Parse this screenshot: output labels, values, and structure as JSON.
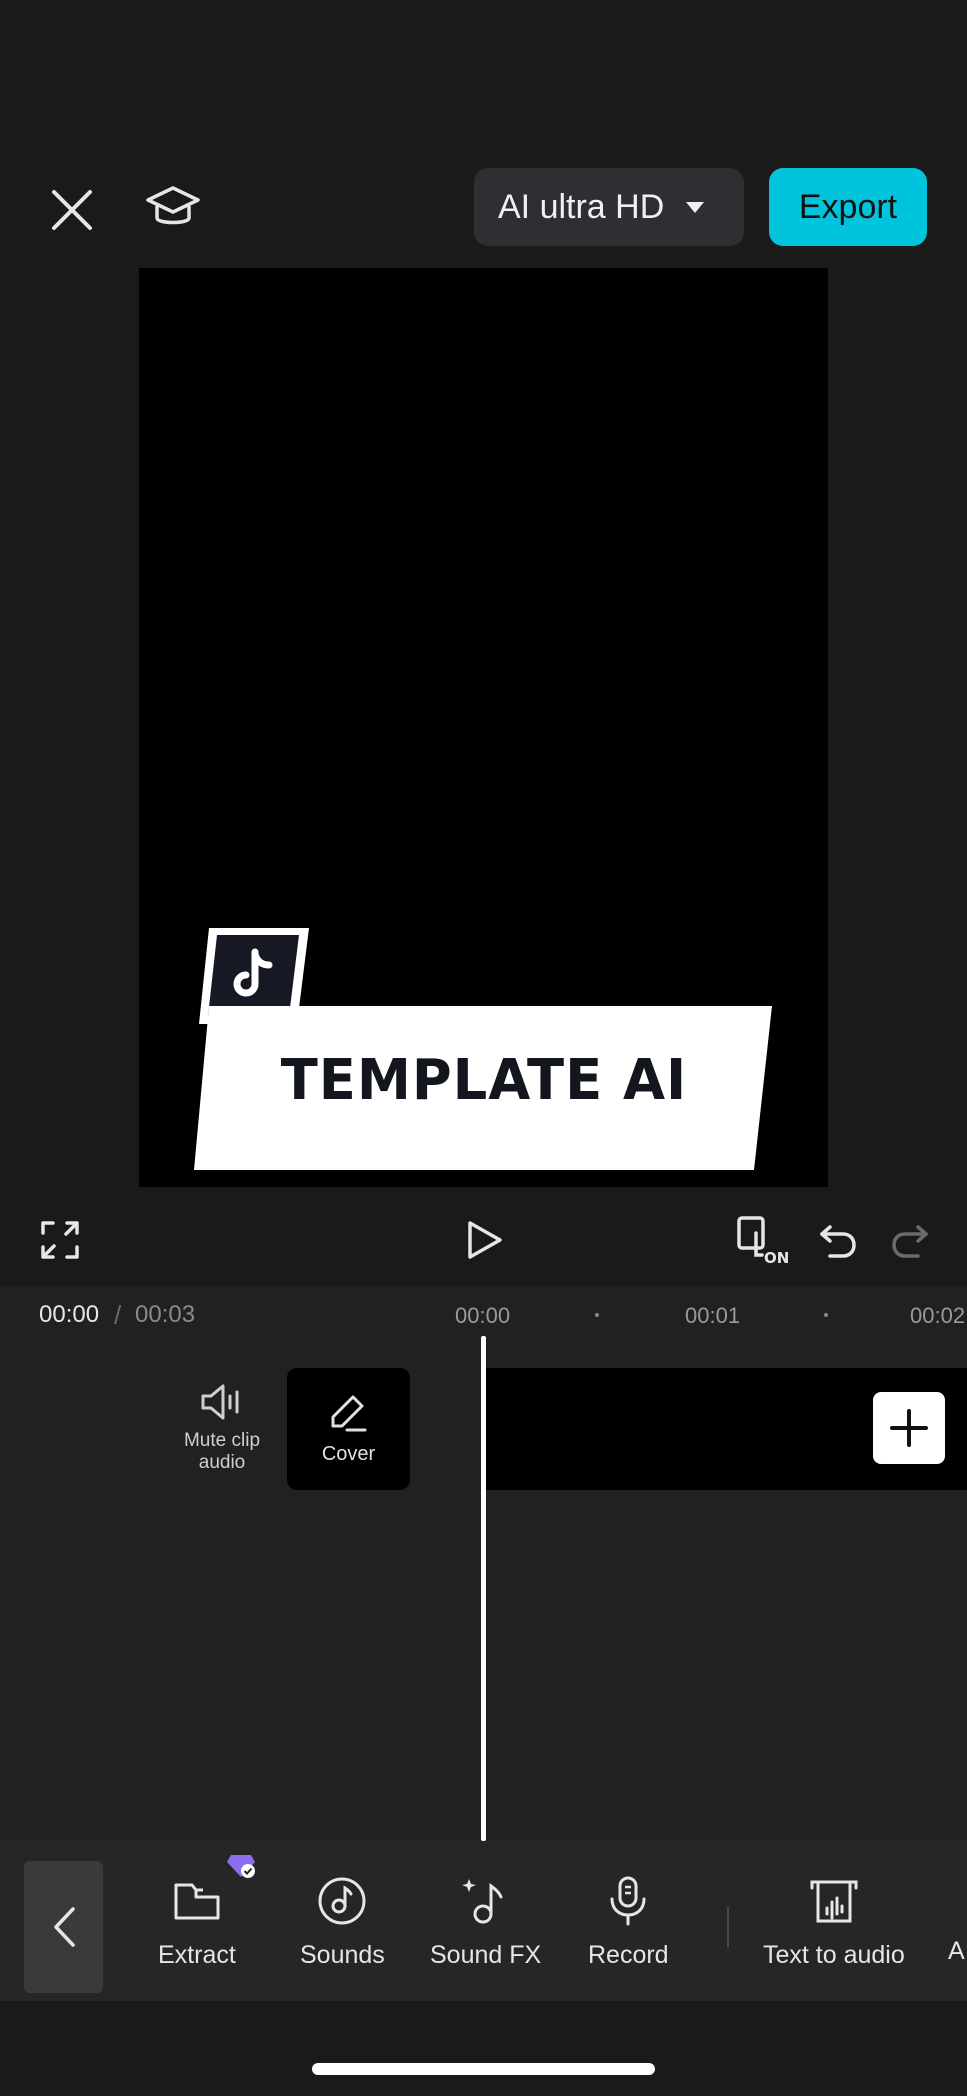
{
  "topbar": {
    "quality_label": "AI ultra HD",
    "export_label": "Export"
  },
  "preview": {
    "template_title": "TEMPLATE AI"
  },
  "timeline": {
    "current_time": "00:00",
    "separator": "/",
    "total_time": "00:03",
    "ruler": [
      "00:00",
      "00:01",
      "00:02"
    ],
    "mute_label": "Mute clip audio",
    "cover_label": "Cover"
  },
  "toolbar": {
    "items": [
      {
        "label": "Extract",
        "icon": "folder-extract-icon"
      },
      {
        "label": "Sounds",
        "icon": "music-disc-icon"
      },
      {
        "label": "Sound FX",
        "icon": "sound-fx-icon"
      },
      {
        "label": "Record",
        "icon": "microphone-icon"
      },
      {
        "label": "Text to audio",
        "icon": "text-to-audio-icon"
      }
    ],
    "cut_off_label": "A"
  },
  "colors": {
    "accent": "#00c4dc",
    "background": "#1a1a1a",
    "premium": "#8e6cf0"
  }
}
